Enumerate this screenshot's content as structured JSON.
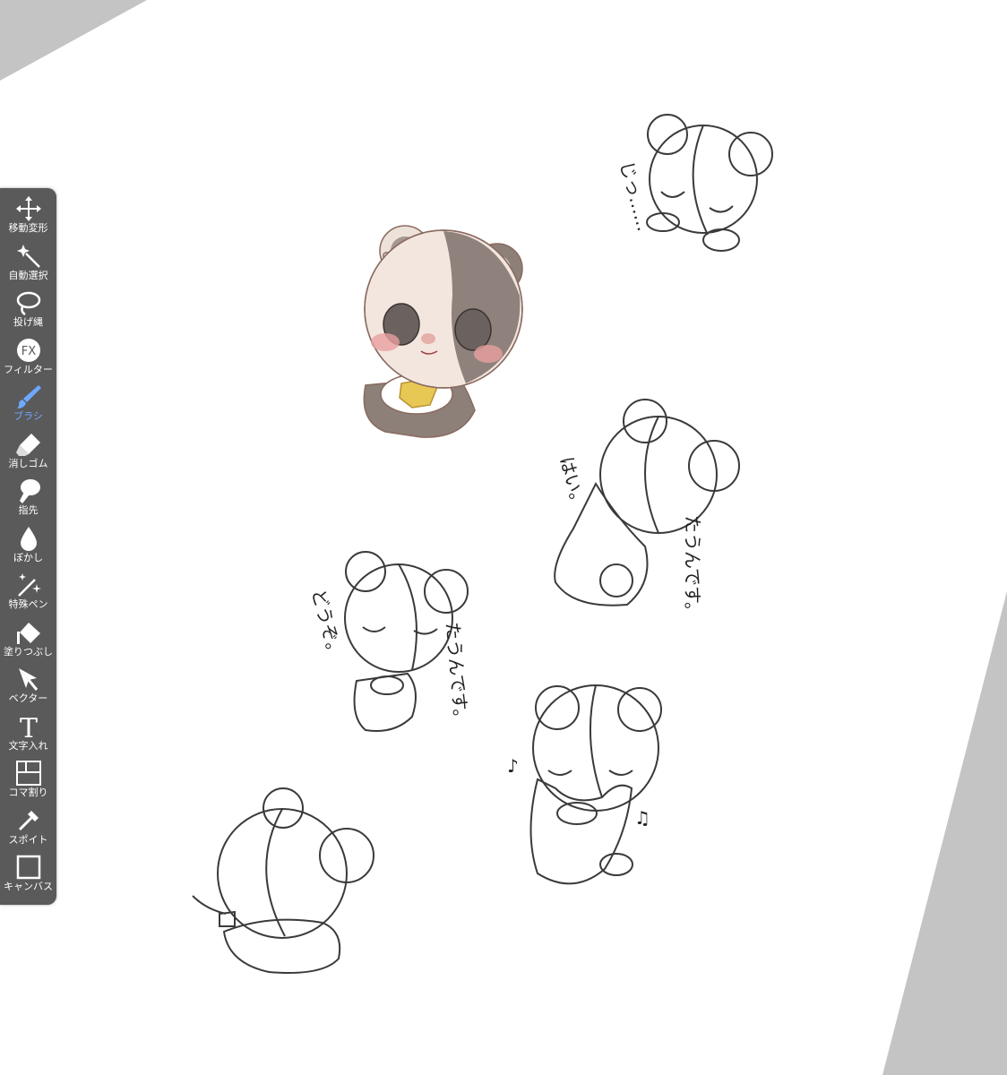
{
  "app": {
    "accent_color": "#6ea8ff",
    "toolbar_bg": "#5a5a5a"
  },
  "toolbar": {
    "items": [
      {
        "label": "移動変形",
        "icon": "move-transform-icon",
        "active": false
      },
      {
        "label": "自動選択",
        "icon": "magic-wand-icon",
        "active": false
      },
      {
        "label": "投げ縄",
        "icon": "lasso-icon",
        "active": false
      },
      {
        "label": "フィルター",
        "icon": "fx-filter-icon",
        "active": false
      },
      {
        "label": "ブラシ",
        "icon": "brush-icon",
        "active": true
      },
      {
        "label": "消しゴム",
        "icon": "eraser-icon",
        "active": false
      },
      {
        "label": "指先",
        "icon": "smudge-finger-icon",
        "active": false
      },
      {
        "label": "ぼかし",
        "icon": "blur-drop-icon",
        "active": false
      },
      {
        "label": "特殊ペン",
        "icon": "special-pen-icon",
        "active": false
      },
      {
        "label": "塗りつぶし",
        "icon": "fill-bucket-icon",
        "active": false
      },
      {
        "label": "ベクター",
        "icon": "vector-cursor-icon",
        "active": false
      },
      {
        "label": "文字入れ",
        "icon": "text-t-icon",
        "active": false
      },
      {
        "label": "コマ割り",
        "icon": "panel-layout-icon",
        "active": false
      },
      {
        "label": "スポイト",
        "icon": "eyedropper-icon",
        "active": false
      },
      {
        "label": "キャンバス",
        "icon": "canvas-square-icon",
        "active": false
      }
    ]
  },
  "drawing": {
    "text_jitto": "じっ……",
    "text_hai": "はい。",
    "text_taun_1": "たうんです。",
    "text_douzo": "どうぞ。",
    "text_taun_2": "たうんです。",
    "note_1": "♪",
    "note_2": "♫"
  }
}
